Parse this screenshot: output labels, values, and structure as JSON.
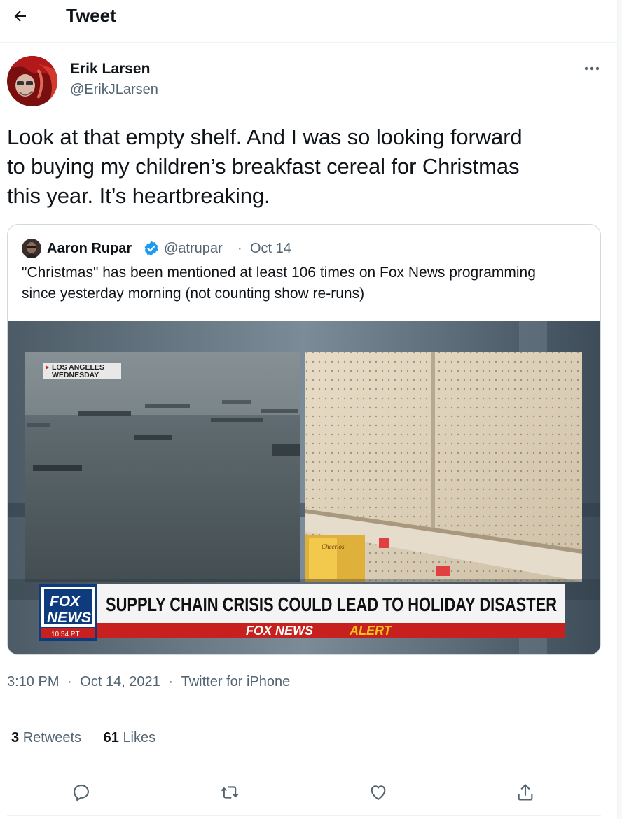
{
  "header": {
    "title": "Tweet"
  },
  "author": {
    "name": "Erik Larsen",
    "handle": "@ErikJLarsen"
  },
  "tweet": {
    "text_lines": [
      "Look at that empty shelf. And I was so looking forward",
      "to buying my children’s breakfast cereal for Christmas",
      "this year. It’s heartbreaking."
    ]
  },
  "quoted": {
    "name": "Aaron Rupar",
    "handle": "@atrupar",
    "separator": "·",
    "date": "Oct 14",
    "text_lines": [
      "\"Christmas\" has been mentioned at least 106 times on Fox News programming",
      "since yesterday morning (not counting show re-runs)"
    ],
    "media": {
      "location_line1": "LOS ANGELES",
      "location_line2": "WEDNESDAY",
      "logo_line1": "FOX",
      "logo_line2": "NEWS",
      "time": "10:54 PT",
      "headline": "SUPPLY CHAIN CRISIS COULD LEAD TO HOLIDAY DISASTER",
      "alert_brand": "FOX NEWS",
      "alert_word": "ALERT",
      "box_label": "Cheerios"
    }
  },
  "meta": {
    "time": "3:10 PM",
    "sep": "·",
    "date": "Oct 14, 2021",
    "source": "Twitter for iPhone"
  },
  "stats": {
    "retweets_count": "3",
    "retweets_label": "Retweets",
    "likes_count": "61",
    "likes_label": "Likes"
  },
  "icons": {
    "back": "arrow-left-icon",
    "more": "more-horizontal-icon",
    "verified": "verified-badge-icon",
    "reply": "reply-icon",
    "retweet": "retweet-icon",
    "like": "heart-icon",
    "share": "share-icon"
  },
  "colors": {
    "text": "#0f1419",
    "secondary": "#536471",
    "border": "#cfd9de",
    "verified": "#1d9bf0",
    "fox_red": "#c8201e",
    "fox_blue": "#0d3b7d",
    "alert_yellow": "#f5c518"
  }
}
